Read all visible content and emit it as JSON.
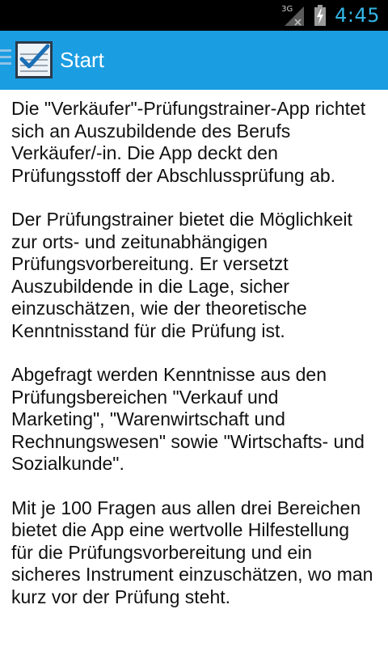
{
  "status_bar": {
    "network_label": "3G",
    "time": "4:45",
    "clock_color": "#33b5e5"
  },
  "action_bar": {
    "title": "Start",
    "background": "#1b9de2",
    "icons": [
      "drawer-icon",
      "app-checklist-icon"
    ]
  },
  "content": {
    "paragraphs": [
      "Die \"Verkäufer\"-Prüfungstrainer-App richtet sich an Auszubildende des Berufs Verkäufer/-in. Die App deckt den Prüfungsstoff der Abschlussprüfung ab.",
      "Der Prüfungstrainer bietet die Möglichkeit zur orts- und zeitunabhängigen Prüfungsvorbereitung. Er versetzt Auszubildende in die Lage, sicher einzuschätzen, wie der theoretische Kenntnisstand für die Prüfung ist.",
      "Abgefragt werden Kenntnisse aus den Prüfungsbereichen \"Verkauf und Marketing\", \"Warenwirtschaft und Rechnungswesen\" sowie \"Wirtschafts- und Sozialkunde\".",
      "Mit je 100 Fragen aus allen drei Bereichen bietet die App eine wertvolle Hilfestellung für die Prüfungsvorbereitung und ein sicheres Instrument einzuschätzen, wo man kurz vor der Prüfung steht."
    ]
  }
}
